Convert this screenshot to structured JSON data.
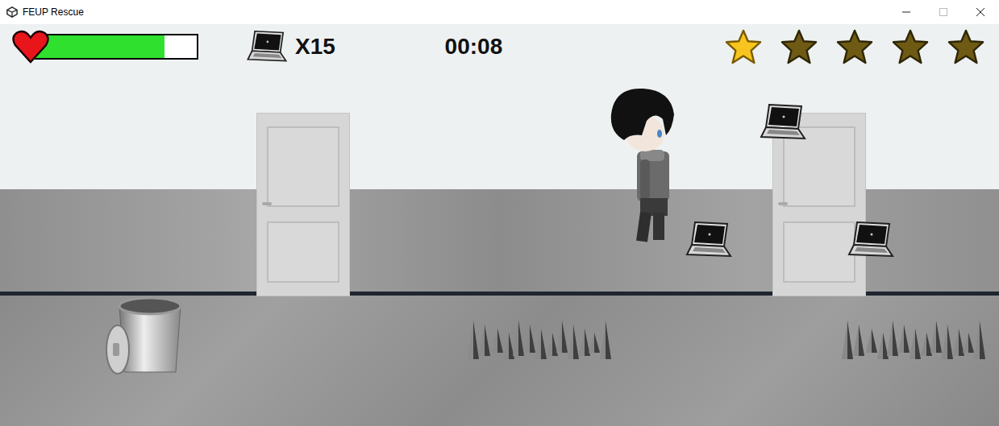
{
  "window": {
    "title": "FEUP Rescue"
  },
  "hud": {
    "health": {
      "level": 0.8
    },
    "laptops": {
      "count": "X15"
    },
    "timer": "00:08",
    "stars": 1,
    "max_stars": 5
  },
  "scene": {
    "entities": [
      {
        "kind": "door"
      },
      {
        "kind": "door"
      },
      {
        "kind": "player"
      },
      {
        "kind": "laptop"
      },
      {
        "kind": "laptop"
      },
      {
        "kind": "laptop"
      },
      {
        "kind": "trash-can"
      },
      {
        "kind": "spikes"
      },
      {
        "kind": "spikes"
      }
    ]
  }
}
